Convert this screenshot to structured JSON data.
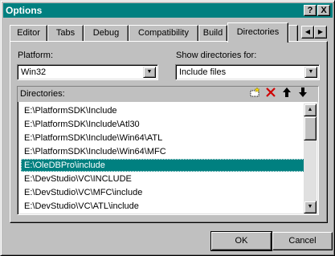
{
  "window": {
    "title": "Options",
    "help_label": "?",
    "close_label": "X"
  },
  "tabs": [
    {
      "label": "Editor"
    },
    {
      "label": "Tabs"
    },
    {
      "label": "Debug"
    },
    {
      "label": "Compatibility"
    },
    {
      "label": "Build"
    },
    {
      "label": "Directories",
      "active": true
    }
  ],
  "platform": {
    "label": "Platform:",
    "value": "Win32"
  },
  "show_dirs": {
    "label": "Show directories for:",
    "value": "Include files"
  },
  "directories": {
    "label": "Directories:",
    "items": [
      "E:\\PlatformSDK\\Include",
      "E:\\PlatformSDK\\Include\\Atl30",
      "E:\\PlatformSDK\\Include\\Win64\\ATL",
      "E:\\PlatformSDK\\Include\\Win64\\MFC",
      "E:\\OleDBPro\\include",
      "E:\\DevStudio\\VC\\INCLUDE",
      "E:\\DevStudio\\VC\\MFC\\include",
      "E:\\DevStudio\\VC\\ATL\\include"
    ],
    "selected_index": 4
  },
  "buttons": {
    "ok": "OK",
    "cancel": "Cancel"
  },
  "icons": {
    "new": "new-folder-icon",
    "delete": "delete-icon",
    "move_up": "move-up-icon",
    "move_down": "move-down-icon"
  },
  "colors": {
    "titlebar": "#008080",
    "selection": "#008080",
    "face": "#c0c0c0"
  }
}
